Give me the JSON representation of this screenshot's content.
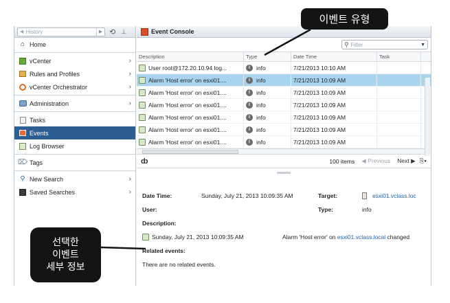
{
  "nav": {
    "history_label": "History",
    "items": [
      {
        "label": "Home",
        "icon": "home-icon"
      },
      {
        "label": "vCenter",
        "icon": "vcenter-icon"
      },
      {
        "label": "Rules and Profiles",
        "icon": "rules-icon"
      },
      {
        "label": "vCenter Orchestrator",
        "icon": "orchestrator-icon"
      },
      {
        "label": "Administration",
        "icon": "administration-icon"
      },
      {
        "label": "Tasks",
        "icon": "tasks-icon"
      },
      {
        "label": "Events",
        "icon": "events-icon"
      },
      {
        "label": "Log Browser",
        "icon": "log-browser-icon"
      },
      {
        "label": "Tags",
        "icon": "tags-icon"
      },
      {
        "label": "New Search",
        "icon": "search-icon"
      },
      {
        "label": "Saved Searches",
        "icon": "saved-search-icon"
      }
    ]
  },
  "console": {
    "title": "Event Console",
    "filter_placeholder": "Filter",
    "columns": [
      "Description",
      "Type",
      "Date Time",
      "Task"
    ],
    "rows": [
      {
        "description": "User root@172.20.10.94 log...",
        "type": "info",
        "datetime": "7/21/2013 10:10 AM",
        "task": ""
      },
      {
        "description": "Alarm 'Host error' on esxi01....",
        "type": "info",
        "datetime": "7/21/2013 10:09 AM",
        "task": "",
        "selected": true
      },
      {
        "description": "Alarm 'Host error' on esxi01....",
        "type": "info",
        "datetime": "7/21/2013 10:09 AM",
        "task": ""
      },
      {
        "description": "Alarm 'Host error' on esxi01....",
        "type": "info",
        "datetime": "7/21/2013 10:09 AM",
        "task": ""
      },
      {
        "description": "Alarm 'Host error' on esxi01....",
        "type": "info",
        "datetime": "7/21/2013 10:09 AM",
        "task": ""
      },
      {
        "description": "Alarm 'Host error' on esxi01....",
        "type": "info",
        "datetime": "7/21/2013 10:09 AM",
        "task": ""
      },
      {
        "description": "Alarm 'Host error' on esxi01....",
        "type": "info",
        "datetime": "7/21/2013 10:09 AM",
        "task": ""
      }
    ],
    "pager": {
      "count": "100 items",
      "previous": "Previous",
      "next": "Next"
    },
    "details": {
      "date_time_label": "Date Time:",
      "date_time_value": "Sunday, July 21, 2013 10:09:35 AM",
      "target_label": "Target:",
      "target_value": "esxi01.vclass.loc",
      "user_label": "User:",
      "type_label": "Type:",
      "type_value": "info",
      "description_label": "Description:",
      "description_time": "Sunday, July 21, 2013 10:09:35 AM",
      "description_prefix": "Alarm 'Host error' on",
      "description_link": "esxi01.vclass.local",
      "description_suffix": "changed",
      "related_label": "Related events:",
      "related_value": "There are no related events."
    }
  },
  "annotations": {
    "event_type": "이벤트 유형",
    "selected_event_details": "선택한\n이벤트\n세부 정보"
  },
  "colors": {
    "selected_nav": "#2e5f93",
    "selected_row": "#a9d4ef",
    "link": "#1f5fa8"
  }
}
